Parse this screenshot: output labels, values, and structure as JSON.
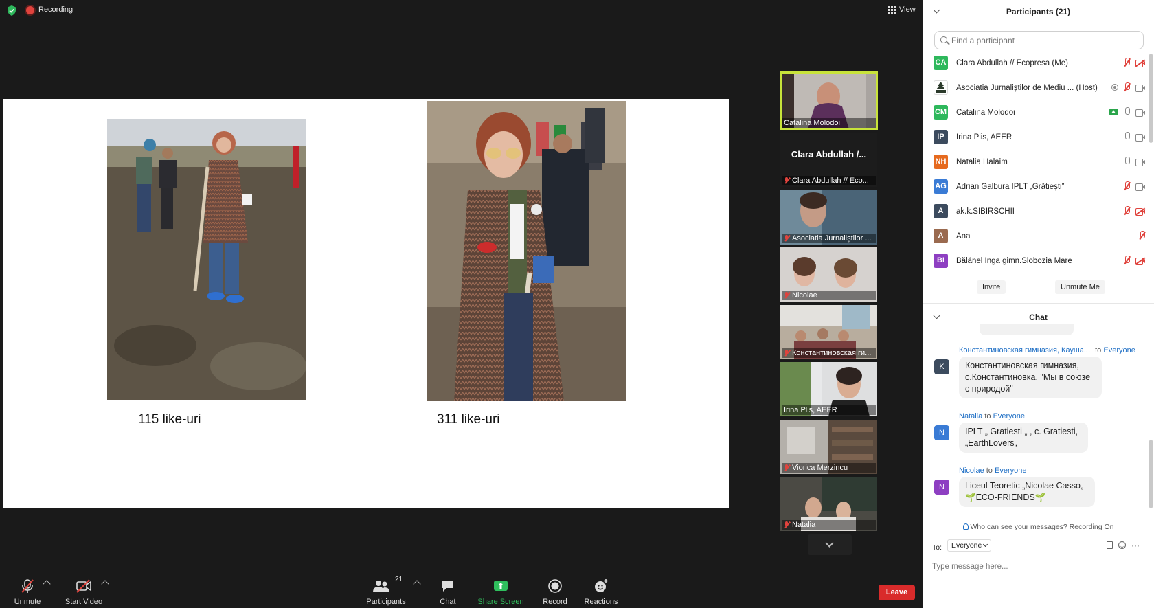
{
  "topbar": {
    "recording_label": "Recording",
    "view_label": "View"
  },
  "slide": {
    "captions": [
      "115 like-uri",
      "311 like-uri"
    ]
  },
  "gallery": {
    "tiles": [
      {
        "name": "Catalina Molodoi",
        "muted": false,
        "active": true
      },
      {
        "big_name": "Clara Abdullah /...",
        "name": "Clara Abdullah // Eco...",
        "muted": true
      },
      {
        "name": "Asociatia Jurnaliștilor ...",
        "muted": true
      },
      {
        "name": "Nicolae",
        "muted": true
      },
      {
        "name": "Константиновская ги...",
        "muted": true
      },
      {
        "name": "Irina Plis, AEER",
        "muted": false
      },
      {
        "name": "Viorica Merzincu",
        "muted": true
      },
      {
        "name": "Natalia",
        "muted": true
      }
    ]
  },
  "toolbar": {
    "unmute": "Unmute",
    "start_video": "Start Video",
    "participants": "Participants",
    "participants_count": "21",
    "chat": "Chat",
    "share_screen": "Share Screen",
    "record": "Record",
    "reactions": "Reactions",
    "leave": "Leave"
  },
  "participants_panel": {
    "title": "Participants (21)",
    "search_placeholder": "Find a participant",
    "participants": [
      {
        "initials": "CA",
        "color": "#2eb85c",
        "name": "Clara Abdullah // Ecopresa (Me)",
        "mic": "off",
        "cam": "off"
      },
      {
        "initials": "",
        "color": "#2b3a2b",
        "name": "Asociatia Jurnaliștilor de Mediu ... (Host)",
        "mic": "off",
        "cam": "on",
        "recording": true,
        "logo": true
      },
      {
        "initials": "CM",
        "color": "#2eb85c",
        "name": "Catalina Molodoi",
        "mic": "on",
        "cam": "on",
        "sharing": true
      },
      {
        "initials": "IP",
        "color": "#3c4b5e",
        "name": "Irina Plis, AEER",
        "mic": "on",
        "cam": "on"
      },
      {
        "initials": "NH",
        "color": "#e66a1f",
        "name": "Natalia Halaim",
        "mic": "on",
        "cam": "on"
      },
      {
        "initials": "AG",
        "color": "#3a7bd5",
        "name": "Adrian Galbura IPLT „Grătiești”",
        "mic": "off",
        "cam": "on"
      },
      {
        "initials": "A",
        "color": "#3c4b5e",
        "name": "ak.k.SIBIRSCHII",
        "mic": "off",
        "cam": "off"
      },
      {
        "initials": "A",
        "color": "#9a6a4f",
        "name": "Ana",
        "mic": "off",
        "cam": "none"
      },
      {
        "initials": "BI",
        "color": "#8e3fc2",
        "name": "Bălănel Inga gimn.Slobozia Mare",
        "mic": "off",
        "cam": "off"
      }
    ],
    "invite_label": "Invite",
    "unmute_me_label": "Unmute Me"
  },
  "chat_panel": {
    "title": "Chat",
    "messages": [
      {
        "sender": "Константиновская гимназия, Кауша...",
        "to": "to",
        "recipient": "Everyone",
        "avatar": "K",
        "avatar_color": "#3c4b5e",
        "lines": [
          "Константиновская гимназия,",
          "с.Константиновка, \"Мы в союзе",
          "с природой\""
        ]
      },
      {
        "sender": "Natalia",
        "to": "to",
        "recipient": "Everyone",
        "avatar": "N",
        "avatar_color": "#3a7bd5",
        "lines": [
          "IPLT „ Gratiesti „  , c. Gratiesti,",
          "„EarthLovers„"
        ]
      },
      {
        "sender": "Nicolae",
        "to": "to",
        "recipient": "Everyone",
        "avatar": "N",
        "avatar_color": "#8e3fc2",
        "lines": [
          "Liceul Teoretic „Nicolae Casso„",
          "🌱ECO-FRIENDS🌱"
        ]
      }
    ],
    "who_can_see": "Who can see your messages? Recording On",
    "to_label": "To:",
    "to_value": "Everyone",
    "input_placeholder": "Type message here..."
  }
}
